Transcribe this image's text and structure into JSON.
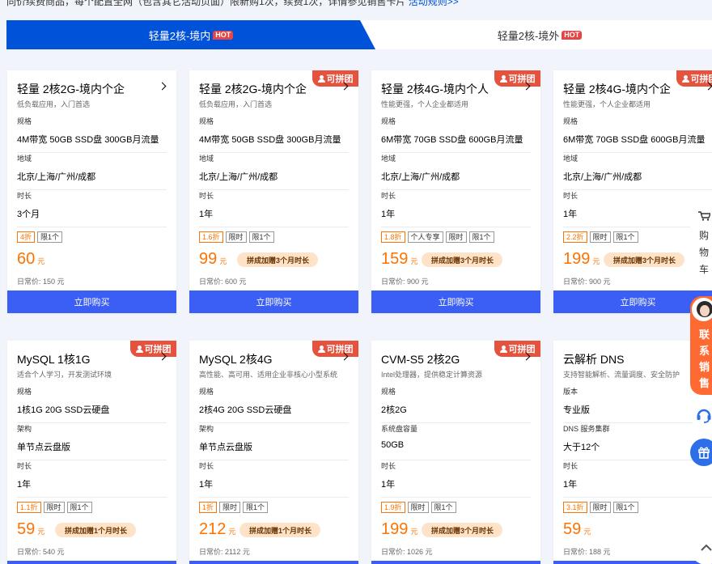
{
  "notice": {
    "text": "同价续费商品，每个配置全网（包含其它活动页面）限新购1次，续费1次，详情参见销售卡片",
    "link": "活动规则>>"
  },
  "tabs": [
    {
      "label": "轻量2核-境内",
      "hot": "HOT"
    },
    {
      "label": "轻量2核-境外",
      "hot": "HOT"
    }
  ],
  "badge_label": "可拼团",
  "buy_label": "立即购买",
  "unit": "元",
  "cards": [
    {
      "title": "轻量 2核2G-境内个企",
      "subtitle": "低负载应用，入门首选",
      "specs": [
        {
          "label": "规格",
          "value": "4M带宽 50GB SSD盘 300GB月流量"
        },
        {
          "label": "地域",
          "value": "北京/上海/广州/成都"
        },
        {
          "label": "时长",
          "value": "3个月"
        }
      ],
      "tags": [
        "4折",
        "限1个"
      ],
      "price": "60",
      "promo": "",
      "daily": "日常价: 150 元"
    },
    {
      "title": "轻量 2核2G-境内个企",
      "subtitle": "低负载应用，入门首选",
      "specs": [
        {
          "label": "规格",
          "value": "4M带宽 50GB SSD盘 300GB月流量"
        },
        {
          "label": "地域",
          "value": "北京/上海/广州/成都"
        },
        {
          "label": "时长",
          "value": "1年"
        }
      ],
      "tags": [
        "1.6折",
        "限时",
        "限1个"
      ],
      "price": "99",
      "promo": "拼成加赠3个月时长",
      "daily": "日常价: 600 元"
    },
    {
      "title": "轻量 2核4G-境内个人",
      "subtitle": "性能更强，个人企业都适用",
      "specs": [
        {
          "label": "规格",
          "value": "6M带宽 70GB SSD盘 600GB月流量"
        },
        {
          "label": "地域",
          "value": "北京/上海/广州/成都"
        },
        {
          "label": "时长",
          "value": "1年"
        }
      ],
      "tags": [
        "1.8折",
        "个人专享",
        "限时",
        "限1个"
      ],
      "price": "159",
      "promo": "拼成加赠3个月时长",
      "daily": "日常价: 900 元"
    },
    {
      "title": "轻量 2核4G-境内个企",
      "subtitle": "性能更强，个人企业都适用",
      "specs": [
        {
          "label": "规格",
          "value": "6M带宽 70GB SSD盘 600GB月流量"
        },
        {
          "label": "地域",
          "value": "北京/上海/广州/成都"
        },
        {
          "label": "时长",
          "value": "1年"
        }
      ],
      "tags": [
        "2.2折",
        "限时",
        "限1个"
      ],
      "price": "199",
      "promo": "拼成加赠3个月时长",
      "daily": "日常价: 900 元"
    },
    {
      "title": "MySQL 1核1G",
      "subtitle": "适合个人学习，开发测试环境",
      "specs": [
        {
          "label": "规格",
          "value": "1核1G 20G SSD云硬盘"
        },
        {
          "label": "架构",
          "value": "单节点云盘版"
        },
        {
          "label": "时长",
          "value": "1年"
        }
      ],
      "tags": [
        "1.1折",
        "限时",
        "限1个"
      ],
      "price": "59",
      "promo": "拼成加赠1个月时长",
      "daily": "日常价: 540 元"
    },
    {
      "title": "MySQL 2核4G",
      "subtitle": "高性能、高可用、适用企业非核心小型系统",
      "specs": [
        {
          "label": "规格",
          "value": "2核4G 20G SSD云硬盘"
        },
        {
          "label": "架构",
          "value": "单节点云盘版"
        },
        {
          "label": "时长",
          "value": "1年"
        }
      ],
      "tags": [
        "1折",
        "限时",
        "限1个"
      ],
      "price": "212",
      "promo": "拼成加赠1个月时长",
      "daily": "日常价: 2112 元"
    },
    {
      "title": "CVM-S5 2核2G",
      "subtitle": "Intel处理器，提供稳定计算资源",
      "specs": [
        {
          "label": "规格",
          "value": "2核2G"
        },
        {
          "label": "系统盘容量",
          "value": "50GB"
        },
        {
          "label": "时长",
          "value": "1年"
        }
      ],
      "tags": [
        "1.9折",
        "限时",
        "限1个"
      ],
      "price": "199",
      "promo": "拼成加赠3个月时长",
      "daily": "日常价: 1026 元"
    },
    {
      "title": "云解析 DNS",
      "subtitle": "支持智能解析、流量调度、安全防护",
      "specs": [
        {
          "label": "版本",
          "value": "专业版"
        },
        {
          "label": "DNS 服务集群",
          "value": "大于12个"
        },
        {
          "label": "时长",
          "value": "1年"
        }
      ],
      "tags": [
        "3.1折",
        "限时",
        "限1个"
      ],
      "price": "59",
      "promo": "",
      "daily": "日常价: 188 元"
    }
  ],
  "sidebar": {
    "cart_label": "购物车",
    "contact_label": "联系销售"
  },
  "colors": {
    "brand_blue": "#0052d9",
    "buy_blue": "#3b5ef5",
    "price_orange": "#ff7200",
    "badge_red": "#e5533f",
    "contact_orange": "#ff6a33"
  }
}
